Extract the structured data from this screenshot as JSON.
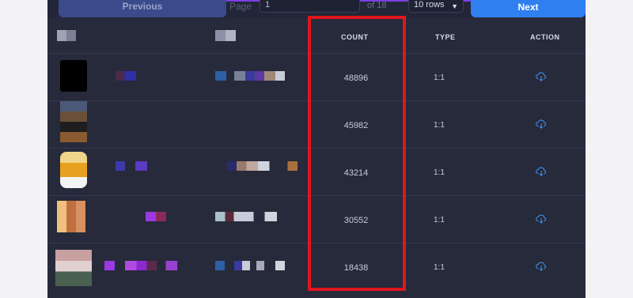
{
  "pagination": {
    "previous_label": "Previous",
    "page_label": "Page",
    "page_value": "1",
    "of_label": "of 18",
    "rows_selected": "10 rows",
    "next_label": "Next"
  },
  "table": {
    "headers": {
      "count": "COUNT",
      "type": "TYPE",
      "action": "ACTION"
    },
    "rows": [
      {
        "count": "48896",
        "type": "1:1"
      },
      {
        "count": "45982",
        "type": "1:1"
      },
      {
        "count": "43214",
        "type": "1:1"
      },
      {
        "count": "30552",
        "type": "1:1"
      },
      {
        "count": "18438",
        "type": "1:1"
      }
    ]
  },
  "icons": {
    "action": "cloud-download-icon",
    "dropdown": "chevron-down-icon"
  },
  "colors": {
    "panel_bg": "#272a3b",
    "next_button": "#2f7ff0",
    "previous_button": "#3a4a8a",
    "highlight": "#e0161d",
    "download_icon": "#3a8fe8"
  }
}
